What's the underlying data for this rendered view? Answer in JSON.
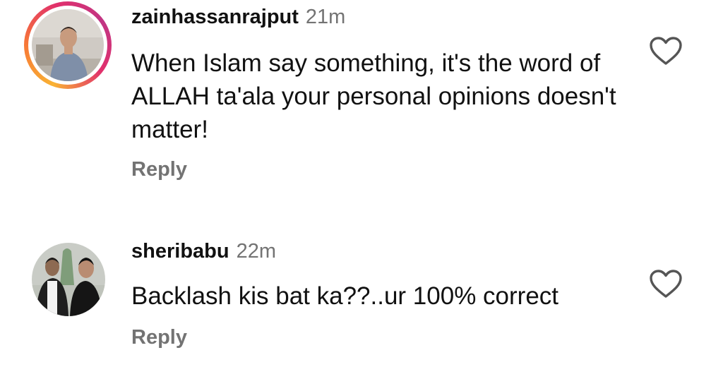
{
  "comments": [
    {
      "username": "zainhassanrajput",
      "time": "21m",
      "text": "When Islam say something, it's the word of ALLAH ta'ala your personal opinions doesn't matter!",
      "reply_label": "Reply",
      "avatar_icon": "avatar-photo",
      "has_story_ring": true,
      "liked": false
    },
    {
      "username": "sheribabu",
      "time": "22m",
      "text": "Backlash kis bat ka??..ur 100% correct",
      "reply_label": "Reply",
      "avatar_icon": "avatar-photo",
      "has_story_ring": false,
      "liked": false
    }
  ],
  "icons": {
    "like": "heart-outline-icon"
  },
  "colors": {
    "text_primary": "#111111",
    "text_secondary": "#737373",
    "story_ring_start": "#f9b233",
    "story_ring_end": "#c13584"
  }
}
